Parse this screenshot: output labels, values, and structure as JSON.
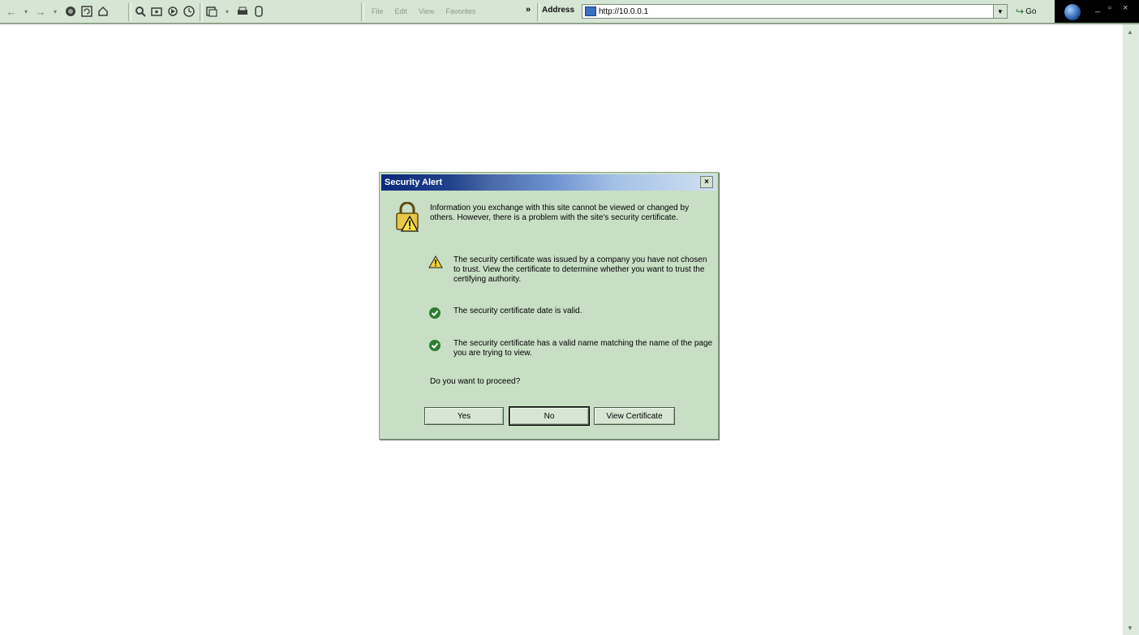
{
  "toolbar": {
    "back": "←",
    "forward": "→",
    "menu": [
      "File",
      "Edit",
      "View",
      "Favorites"
    ],
    "chevron": "»"
  },
  "address_bar": {
    "label": "Address",
    "url": "http://10.0.0.1",
    "dropdown": "▼",
    "go_label": "Go"
  },
  "window_controls": {
    "minimize": "_",
    "maximize": "▫",
    "close": "×"
  },
  "scrollbar": {
    "up": "▲",
    "down": "▼"
  },
  "dialog": {
    "title": "Security Alert",
    "close": "×",
    "intro": "Information you exchange with this site cannot be viewed or changed by others. However, there is a problem with the site's security certificate.",
    "checks": [
      {
        "status": "warning",
        "text": "The security certificate was issued by a company you have not chosen to trust. View the certificate to determine whether you want to trust the certifying authority."
      },
      {
        "status": "ok",
        "text": "The security certificate date is valid."
      },
      {
        "status": "ok",
        "text": "The security certificate has a valid name matching the name of the page you are trying to view."
      }
    ],
    "question": "Do you want to proceed?",
    "buttons": {
      "yes": "Yes",
      "no": "No",
      "view_certificate": "View Certificate"
    }
  },
  "colors": {
    "chrome": "#d6e6d4",
    "dialog_bg": "#c8dfc5",
    "title_gradient_start": "#0b2a7a",
    "ok_green": "#2e7d32",
    "warning_yellow": "#f4d23a"
  }
}
